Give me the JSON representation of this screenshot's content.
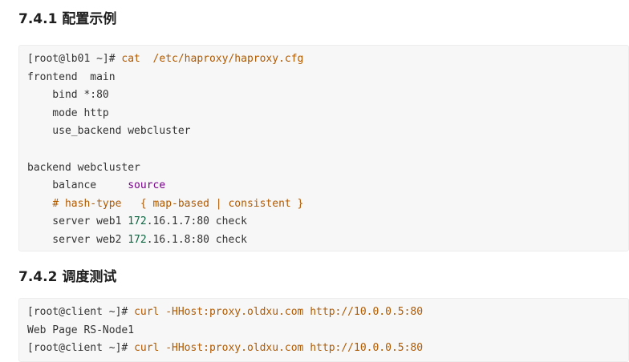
{
  "sections": [
    {
      "heading": "7.4.1 配置示例",
      "lines": [
        [
          {
            "t": "[root@lb01 ~]# ",
            "k": "plain"
          },
          {
            "t": "cat  /etc/haproxy/haproxy.cfg",
            "k": "cmd"
          }
        ],
        [
          {
            "t": "frontend  main",
            "k": "plain"
          }
        ],
        [
          {
            "t": "    bind *:80",
            "k": "plain"
          }
        ],
        [
          {
            "t": "    mode http",
            "k": "plain"
          }
        ],
        [
          {
            "t": "    use_backend webcluster",
            "k": "plain"
          }
        ],
        [
          {
            "t": "",
            "k": "plain"
          }
        ],
        [
          {
            "t": "backend webcluster",
            "k": "plain"
          }
        ],
        [
          {
            "t": "    balance     ",
            "k": "plain"
          },
          {
            "t": "source",
            "k": "kw"
          }
        ],
        [
          {
            "t": "    ",
            "k": "plain"
          },
          {
            "t": "# hash-type   { map-based | consistent }",
            "k": "cmt"
          }
        ],
        [
          {
            "t": "    server web1 ",
            "k": "plain"
          },
          {
            "t": "172",
            "k": "num"
          },
          {
            "t": ".16.1.7:80 check",
            "k": "plain"
          }
        ],
        [
          {
            "t": "    server web2 ",
            "k": "plain"
          },
          {
            "t": "172",
            "k": "num"
          },
          {
            "t": ".16.1.8:80 check",
            "k": "plain"
          }
        ]
      ]
    },
    {
      "heading": "7.4.2 调度测试",
      "lines": [
        [
          {
            "t": "[root@client ~]# ",
            "k": "plain"
          },
          {
            "t": "curl -HHost:proxy.oldxu.com http://10.0.0.5:80",
            "k": "cmd"
          }
        ],
        [
          {
            "t": "Web Page RS-Node1",
            "k": "plain"
          }
        ],
        [
          {
            "t": "[root@client ~]# ",
            "k": "plain"
          },
          {
            "t": "curl -HHost:proxy.oldxu.com http://10.0.0.5:80",
            "k": "cmd"
          }
        ]
      ]
    }
  ],
  "colors": {
    "command": "#b05a00",
    "keyword": "#770088",
    "comment": "#b05a00",
    "number": "#116644",
    "code_background": "#f7f7f7"
  }
}
